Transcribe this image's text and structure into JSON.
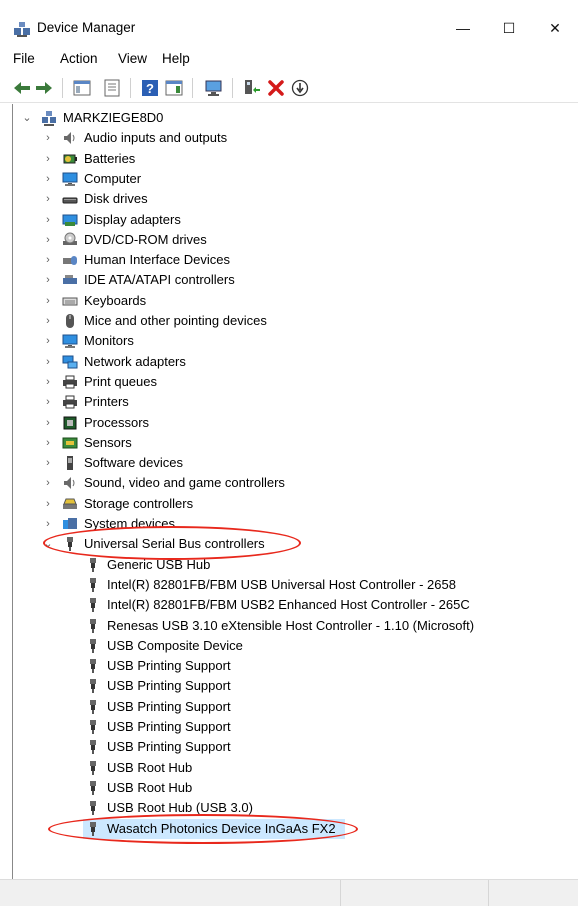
{
  "window": {
    "title": "Device Manager",
    "controls": [
      "—",
      "☐",
      "✕"
    ]
  },
  "menu": [
    "File",
    "Action",
    "View",
    "Help"
  ],
  "toolbar": [
    "back-icon",
    "forward-icon",
    "show-hide-console-tree-icon",
    "properties-icon",
    "help-icon",
    "action-pane-icon",
    "scan-hardware-icon",
    "enable-device-icon",
    "uninstall-device-icon",
    "update-driver-icon"
  ],
  "tree": {
    "root": "MARKZIEGE8D0",
    "categories": [
      {
        "label": "Audio inputs and outputs",
        "icon": "speaker-icon"
      },
      {
        "label": "Batteries",
        "icon": "battery-icon"
      },
      {
        "label": "Computer",
        "icon": "computer-icon"
      },
      {
        "label": "Disk drives",
        "icon": "disk-drive-icon"
      },
      {
        "label": "Display adapters",
        "icon": "display-adapter-icon"
      },
      {
        "label": "DVD/CD-ROM drives",
        "icon": "dvd-icon"
      },
      {
        "label": "Human Interface Devices",
        "icon": "hid-icon"
      },
      {
        "label": "IDE ATA/ATAPI controllers",
        "icon": "ide-icon"
      },
      {
        "label": "Keyboards",
        "icon": "keyboard-icon"
      },
      {
        "label": "Mice and other pointing devices",
        "icon": "mouse-icon"
      },
      {
        "label": "Monitors",
        "icon": "monitor-icon"
      },
      {
        "label": "Network adapters",
        "icon": "network-icon"
      },
      {
        "label": "Print queues",
        "icon": "printer-icon"
      },
      {
        "label": "Printers",
        "icon": "printer-icon"
      },
      {
        "label": "Processors",
        "icon": "processor-icon"
      },
      {
        "label": "Sensors",
        "icon": "sensor-icon"
      },
      {
        "label": "Software devices",
        "icon": "software-device-icon"
      },
      {
        "label": "Sound, video and game controllers",
        "icon": "speaker-icon"
      },
      {
        "label": "Storage controllers",
        "icon": "storage-icon"
      },
      {
        "label": "System devices",
        "icon": "system-icon"
      },
      {
        "label": "Universal Serial Bus controllers",
        "icon": "usb-icon",
        "expanded": true
      }
    ],
    "usb_children": [
      "Generic USB Hub",
      "Intel(R) 82801FB/FBM USB Universal Host Controller - 2658",
      "Intel(R) 82801FB/FBM USB2 Enhanced Host Controller - 265C",
      "Renesas USB 3.10 eXtensible Host Controller - 1.10 (Microsoft)",
      "USB Composite Device",
      "USB Printing Support",
      "USB Printing Support",
      "USB Printing Support",
      "USB Printing Support",
      "USB Printing Support",
      "USB Root Hub",
      "USB Root Hub",
      "USB Root Hub (USB 3.0)",
      "Wasatch Photonics Device InGaAs FX2"
    ],
    "selected": "Wasatch Photonics Device InGaAs FX2"
  },
  "colors": {
    "selection": "#cce8ff",
    "annotation": "#e8281c"
  }
}
